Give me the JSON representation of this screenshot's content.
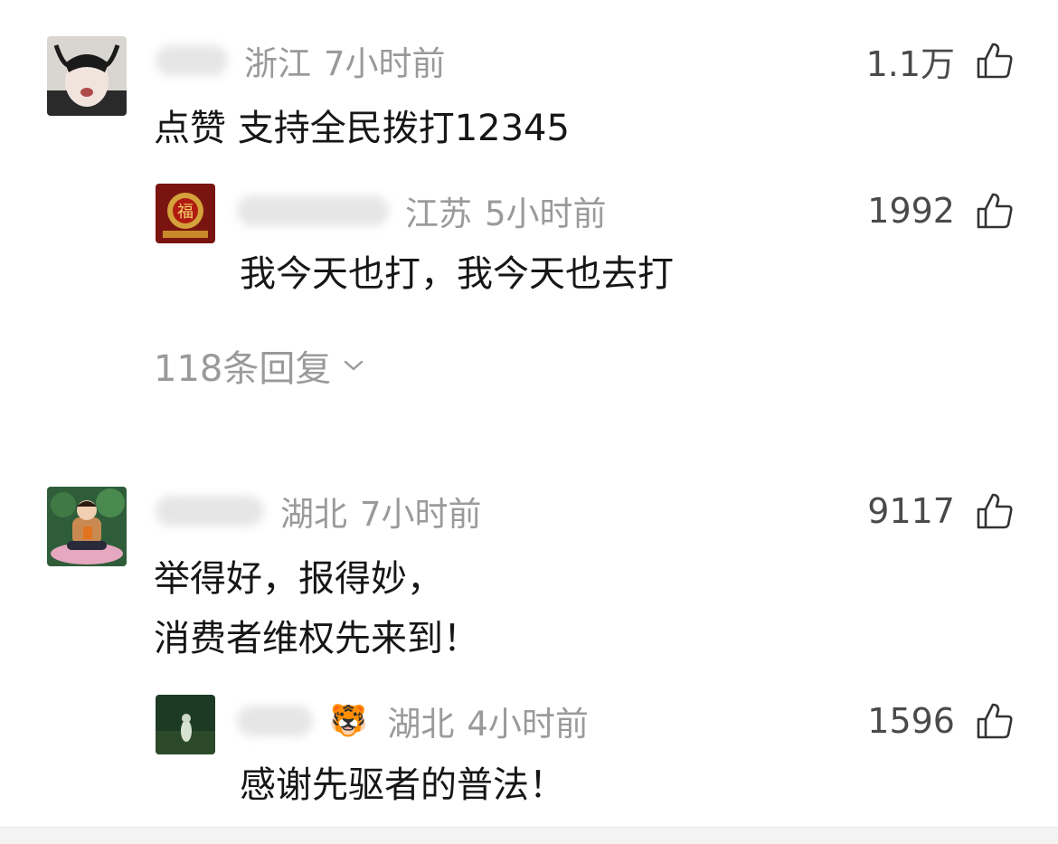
{
  "comments": [
    {
      "region": "浙江",
      "time": "7小时前",
      "likes": "1.1万",
      "text": "点赞 支持全民拨打12345",
      "reply": {
        "region": "江苏",
        "time": "5小时前",
        "likes": "1992",
        "text": "我今天也打，我今天也去打"
      },
      "more_replies": "118条回复"
    },
    {
      "region": "湖北",
      "time": "7小时前",
      "likes": "9117",
      "text_lines": [
        "举得好，报得妙，",
        "消费者维权先来到！"
      ],
      "reply": {
        "region": "湖北",
        "time": "4小时前",
        "likes": "1596",
        "name_emoji": "🐯",
        "text": "感谢先驱者的普法！"
      }
    }
  ],
  "colors": {
    "meta": "#9a9a9a",
    "text": "#161616",
    "likes": "#4a4a4a"
  },
  "icons": [
    "thumbs-up-icon",
    "chevron-down-icon"
  ]
}
